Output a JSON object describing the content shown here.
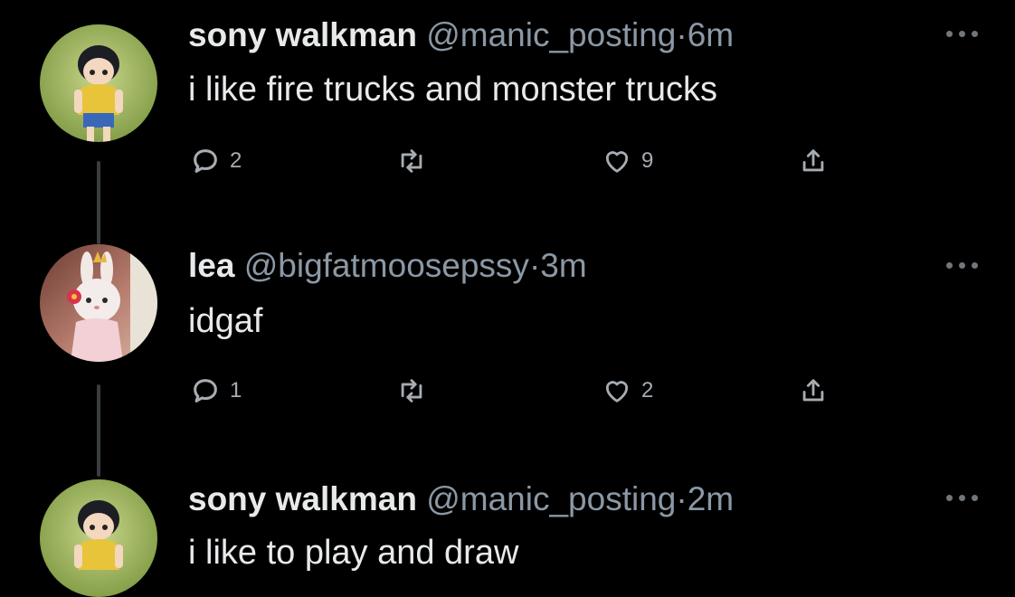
{
  "tweets": [
    {
      "display_name": "sony walkman",
      "handle": "@manic_posting",
      "separator": "·",
      "time": "6m",
      "text": "i like fire trucks and monster trucks",
      "reply_count": "2",
      "like_count": "9",
      "avatar": "shinji-avatar"
    },
    {
      "display_name": "lea",
      "handle": "@bigfatmoosepssy",
      "separator": "·",
      "time": "3m",
      "text": "idgaf",
      "reply_count": "1",
      "like_count": "2",
      "avatar": "bunny-avatar"
    },
    {
      "display_name": "sony walkman",
      "handle": "@manic_posting",
      "separator": "·",
      "time": "2m",
      "text": "i like to play and draw",
      "avatar": "shinji-avatar"
    }
  ],
  "icons": {
    "reply": "reply-icon",
    "retweet": "retweet-icon",
    "like": "heart-icon",
    "share": "share-icon",
    "more": "more-icon"
  },
  "colors": {
    "background": "#000000",
    "primary_text": "#e7e9ea",
    "secondary_text": "#8b98a5",
    "icon": "#a6acb2",
    "thread_line": "#3a3d40"
  }
}
